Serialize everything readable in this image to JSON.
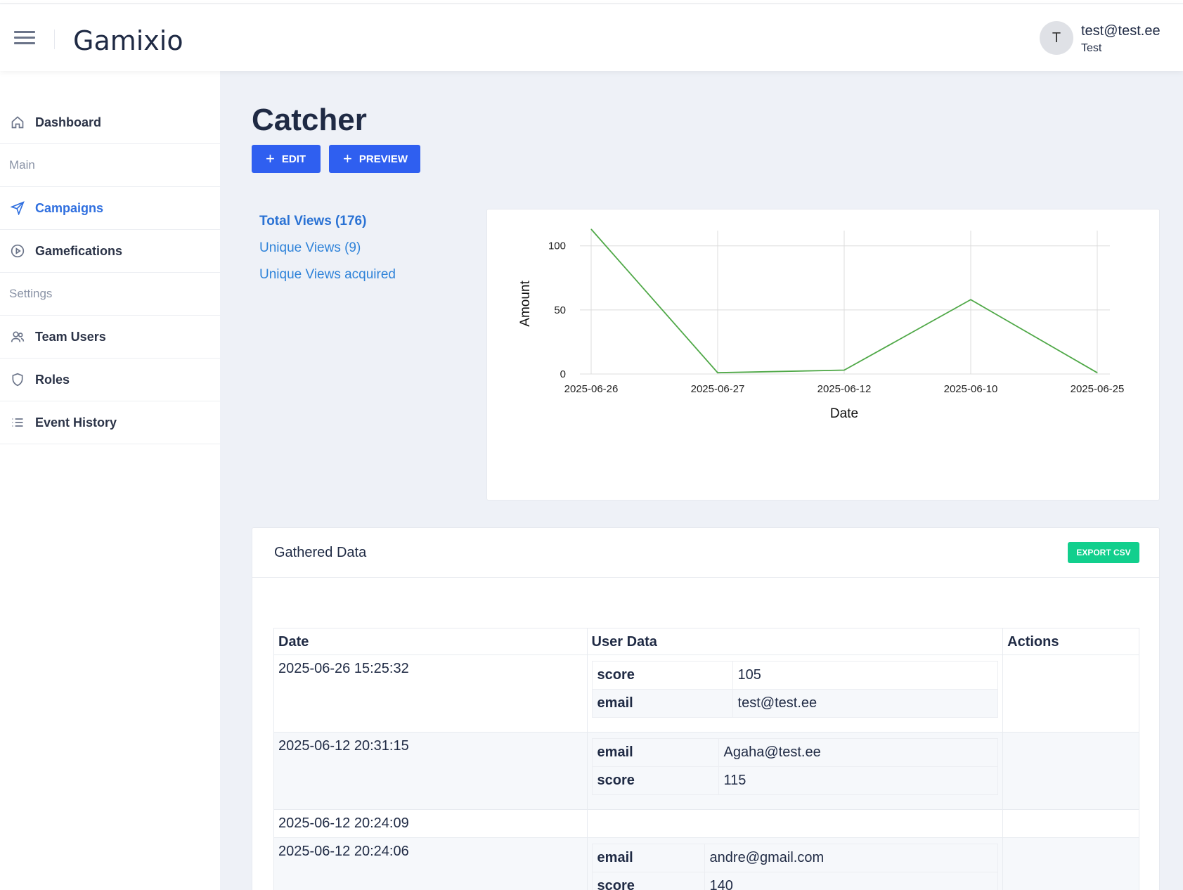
{
  "header": {
    "brand": "Gamixio",
    "user_initial": "T",
    "user_email": "test@test.ee",
    "user_name": "Test"
  },
  "sidebar": {
    "items": [
      {
        "label": "Dashboard",
        "icon": "home-icon"
      },
      {
        "label": "Main",
        "section": true
      },
      {
        "label": "Campaigns",
        "icon": "send-icon",
        "active": true
      },
      {
        "label": "Gamefications",
        "icon": "play-circle-icon"
      },
      {
        "label": "Settings",
        "section": true
      },
      {
        "label": "Team Users",
        "icon": "users-icon"
      },
      {
        "label": "Roles",
        "icon": "shield-icon"
      },
      {
        "label": "Event History",
        "icon": "list-icon"
      }
    ]
  },
  "page": {
    "title": "Catcher",
    "edit_label": "EDIT",
    "preview_label": "PREVIEW"
  },
  "stats": {
    "total_views": "Total Views (176)",
    "unique_views": "Unique Views (9)",
    "unique_views_acquired": "Unique Views acquired"
  },
  "chart_data": {
    "type": "line",
    "x": [
      "2025-06-26",
      "2025-06-27",
      "2025-06-12",
      "2025-06-10",
      "2025-06-25"
    ],
    "series": [
      {
        "values": [
          113,
          1,
          3,
          58,
          1
        ]
      }
    ],
    "xlabel": "Date",
    "ylabel": "Amount",
    "ylim": [
      0,
      113
    ],
    "yticks": [
      0,
      50,
      100
    ],
    "grid": true,
    "line_color": "#4fa847"
  },
  "gathered": {
    "title": "Gathered Data",
    "export_label": "EXPORT CSV",
    "columns": [
      "Date",
      "User Data",
      "Actions"
    ],
    "rows": [
      {
        "date": "2025-06-26 15:25:32",
        "data": [
          [
            "score",
            "105"
          ],
          [
            "email",
            "test@test.ee"
          ]
        ]
      },
      {
        "date": "2025-06-12 20:31:15",
        "data": [
          [
            "email",
            "Agaha@test.ee"
          ],
          [
            "score",
            "115"
          ]
        ]
      },
      {
        "date": "2025-06-12 20:24:09",
        "data": []
      },
      {
        "date": "2025-06-12 20:24:06",
        "data": [
          [
            "email",
            "andre@gmail.com"
          ],
          [
            "score",
            "140"
          ]
        ]
      }
    ]
  },
  "colors": {
    "accent": "#2f5ff0",
    "link": "#2f83d9",
    "export": "#12cf8d"
  }
}
